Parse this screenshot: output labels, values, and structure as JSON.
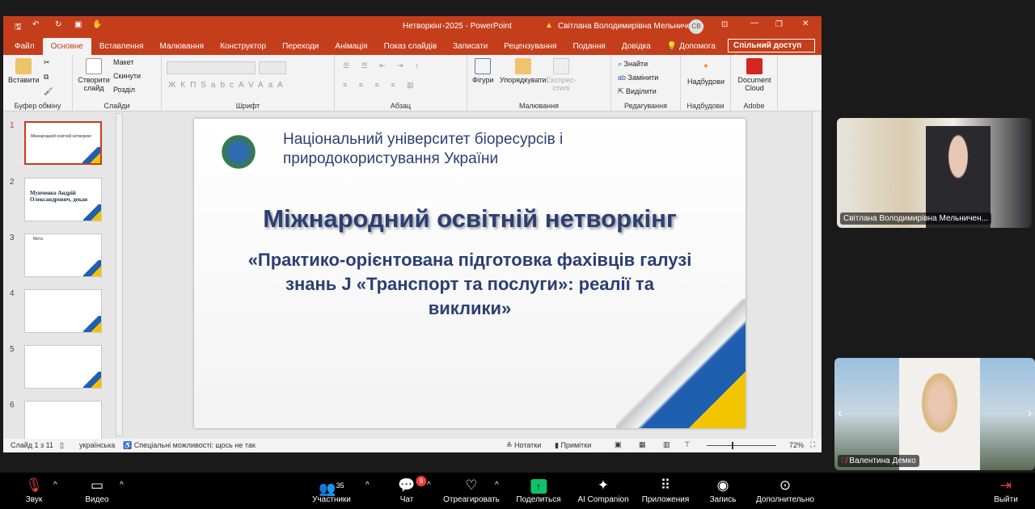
{
  "window": {
    "title": "Нетворкінг-2025 - PowerPoint",
    "user": "Світлана Володимирівна Мельниченко",
    "user_initials": "СВ",
    "share_label": "Спільний доступ"
  },
  "tabs": [
    "Файл",
    "Основне",
    "Вставлення",
    "Малювання",
    "Конструктор",
    "Переходи",
    "Анімація",
    "Показ слайдів",
    "Записати",
    "Рецензування",
    "Подання",
    "Довідка",
    "Допомога"
  ],
  "ribbon": {
    "paste": "Вставити",
    "clipboard": "Буфер обміну",
    "new_slide": "Створити слайд",
    "layout": "Макет",
    "reset": "Скинути",
    "section": "Розділ",
    "slides": "Слайди",
    "font": "Шрифт",
    "paragraph": "Абзац",
    "shapes": "Фігури",
    "arrange": "Упорядкувати",
    "quick_styles": "Експрес-стилі",
    "drawing": "Малювання",
    "find": "Знайти",
    "replace": "Замінити",
    "select": "Виділити",
    "editing": "Редагування",
    "addins": "Надбудови",
    "addins_group": "Надбудови",
    "doc_cloud": "Document Cloud",
    "adobe": "Adobe",
    "font_buttons": [
      "Ж",
      "К",
      "П",
      "S",
      "abc",
      "AV",
      "Aa",
      "A"
    ]
  },
  "thumbnails": [
    {
      "num": "1",
      "text": "Міжнародний освітній нетворкінг"
    },
    {
      "num": "2",
      "text": "Мунченко Андрій Олександрович, декан"
    },
    {
      "num": "3",
      "text": "Мета"
    },
    {
      "num": "4",
      "text": ""
    },
    {
      "num": "5",
      "text": ""
    },
    {
      "num": "6",
      "text": ""
    }
  ],
  "slide": {
    "university": "Національний університет біоресурсів і природокористування України",
    "title": "Міжнародний освітній нетворкінг",
    "subtitle": "«Практико-орієнтована підготовка фахівців галузі знань J «Транспорт та послуги»: реалії та виклики»"
  },
  "status": {
    "slide": "Слайд 1 з 11",
    "language": "українська",
    "accessibility": "Спеціальні можливості: щось не так",
    "notes": "Нотатки",
    "comments": "Примітки",
    "zoom": "72%",
    "zoom_level": 72
  },
  "participants": [
    {
      "name": "Світлана Володимирівна Мельничен..."
    },
    {
      "name": "Валентина Демко"
    }
  ],
  "zoom_toolbar": {
    "audio": "Звук",
    "video": "Видео",
    "participants": "Участники",
    "participants_count": "35",
    "chat": "Чат",
    "chat_badge": "9",
    "react": "Отреагировать",
    "share": "Поделиться",
    "ai": "AI Companion",
    "apps": "Приложения",
    "record": "Запись",
    "more": "Дополнительно",
    "leave": "Выйти"
  },
  "colors": {
    "ppt_accent": "#c43e1c",
    "share_green": "#0ec26b",
    "badge_red": "#e8403a"
  }
}
